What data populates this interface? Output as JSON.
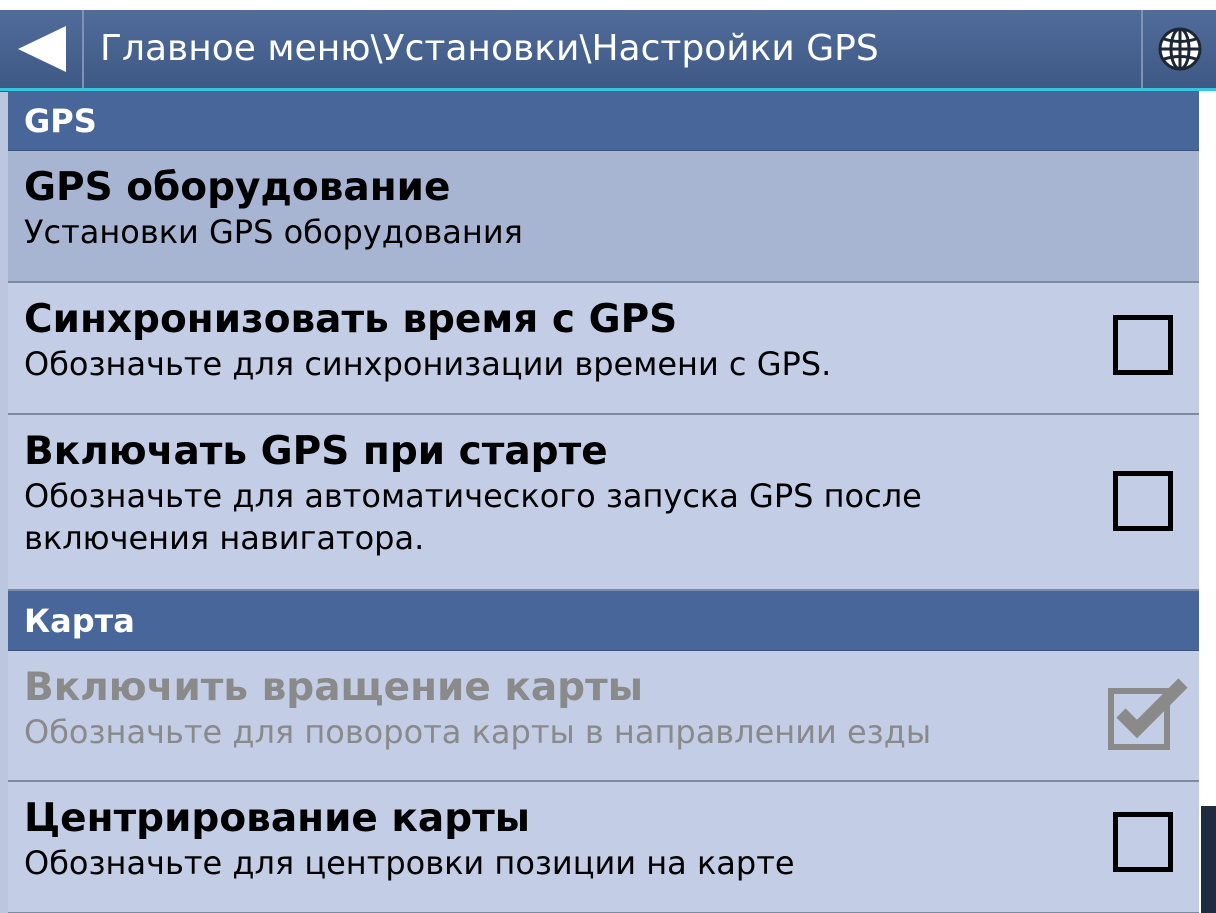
{
  "header": {
    "title": "Главное меню\\Установки\\Настройки GPS",
    "back_icon": "back-arrow-icon",
    "globe_icon": "globe-icon"
  },
  "colors": {
    "header": "#48669a",
    "item_bg": "#c3cee6",
    "selected_bg": "#a7b4d2",
    "accent_line": "#36c7e0",
    "disabled_text": "#8a8a8a"
  },
  "sections": [
    {
      "label": "GPS"
    },
    {
      "label": "Карта"
    }
  ],
  "items": [
    {
      "title": "GPS оборудование",
      "desc": "Установки GPS оборудования",
      "selected": true
    },
    {
      "title": "Синхронизовать время с GPS",
      "desc": "Обозначьте для синхронизации времени с GPS.",
      "checked": false
    },
    {
      "title": "Включать GPS при старте",
      "desc": "Обозначьте для автоматического запуска GPS после включения навигатора.",
      "checked": false
    },
    {
      "title": "Включить вращение карты",
      "desc": "Обозначьте для поворота карты в направлении езды",
      "checked": true,
      "disabled": true
    },
    {
      "title": "Центрирование карты",
      "desc": "Обозначьте для центровки позиции на карте",
      "checked": false
    }
  ]
}
